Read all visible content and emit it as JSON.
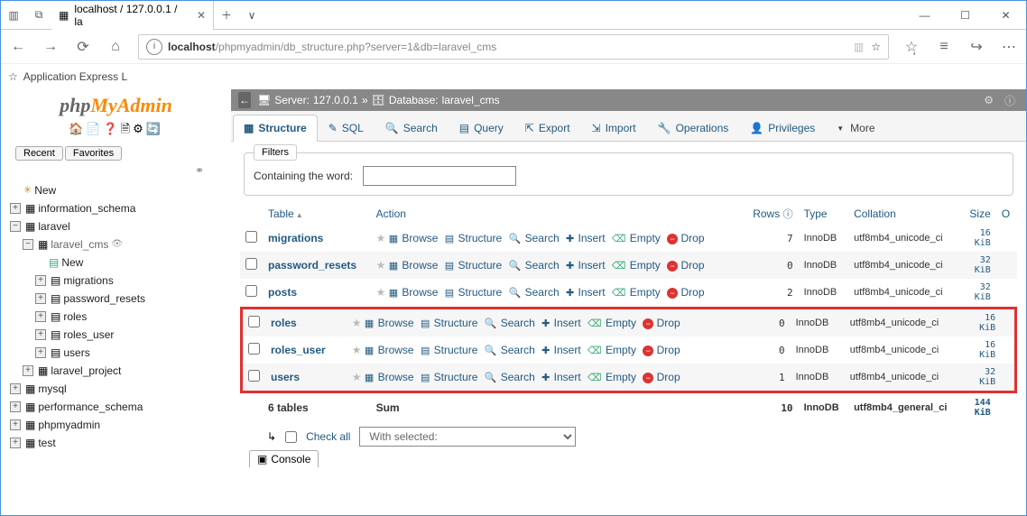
{
  "browser": {
    "tab_title": "localhost / 127.0.0.1 / la",
    "url_host": "localhost",
    "url_path": "/phpmyadmin/db_structure.php?server=1&db=laravel_cms",
    "bookmark": "Application Express L"
  },
  "logo": {
    "php": "php",
    "my": "My",
    "admin": "Admin"
  },
  "recent": "Recent",
  "favorites": "Favorites",
  "tree": {
    "new": "New",
    "items": [
      {
        "label": "information_schema"
      },
      {
        "label": "laravel"
      },
      {
        "label": "laravel_cms",
        "children": [
          {
            "label": "New"
          },
          {
            "label": "migrations"
          },
          {
            "label": "password_resets"
          },
          {
            "label": "roles"
          },
          {
            "label": "roles_user"
          },
          {
            "label": "users"
          }
        ]
      },
      {
        "label": "laravel_project"
      },
      {
        "label": "mysql"
      },
      {
        "label": "performance_schema"
      },
      {
        "label": "phpmyadmin"
      },
      {
        "label": "test"
      }
    ]
  },
  "crumb": {
    "server_label": "Server:",
    "server": "127.0.0.1",
    "db_label": "Database:",
    "db": "laravel_cms"
  },
  "tabs": {
    "structure": "Structure",
    "sql": "SQL",
    "search": "Search",
    "query": "Query",
    "export": "Export",
    "import": "Import",
    "operations": "Operations",
    "privileges": "Privileges",
    "more": "More"
  },
  "filters": {
    "legend": "Filters",
    "label": "Containing the word:",
    "value": ""
  },
  "headers": {
    "table": "Table",
    "action": "Action",
    "rows": "Rows",
    "type": "Type",
    "collation": "Collation",
    "size": "Size",
    "overhead": "O"
  },
  "actions": {
    "browse": "Browse",
    "structure": "Structure",
    "search": "Search",
    "insert": "Insert",
    "empty": "Empty",
    "drop": "Drop"
  },
  "tables": [
    {
      "name": "migrations",
      "rows": "7",
      "type": "InnoDB",
      "collation": "utf8mb4_unicode_ci",
      "size": "16 KiB"
    },
    {
      "name": "password_resets",
      "rows": "0",
      "type": "InnoDB",
      "collation": "utf8mb4_unicode_ci",
      "size": "32 KiB"
    },
    {
      "name": "posts",
      "rows": "2",
      "type": "InnoDB",
      "collation": "utf8mb4_unicode_ci",
      "size": "32 KiB"
    },
    {
      "name": "roles",
      "rows": "0",
      "type": "InnoDB",
      "collation": "utf8mb4_unicode_ci",
      "size": "16 KiB"
    },
    {
      "name": "roles_user",
      "rows": "0",
      "type": "InnoDB",
      "collation": "utf8mb4_unicode_ci",
      "size": "16 KiB"
    },
    {
      "name": "users",
      "rows": "1",
      "type": "InnoDB",
      "collation": "utf8mb4_unicode_ci",
      "size": "32 KiB"
    }
  ],
  "sum": {
    "label": "6 tables",
    "sum": "Sum",
    "rows": "10",
    "type": "InnoDB",
    "collation": "utf8mb4_general_ci",
    "size": "144 KiB"
  },
  "footer": {
    "check_all": "Check all",
    "with_selected": "With selected:",
    "console": "Console"
  }
}
